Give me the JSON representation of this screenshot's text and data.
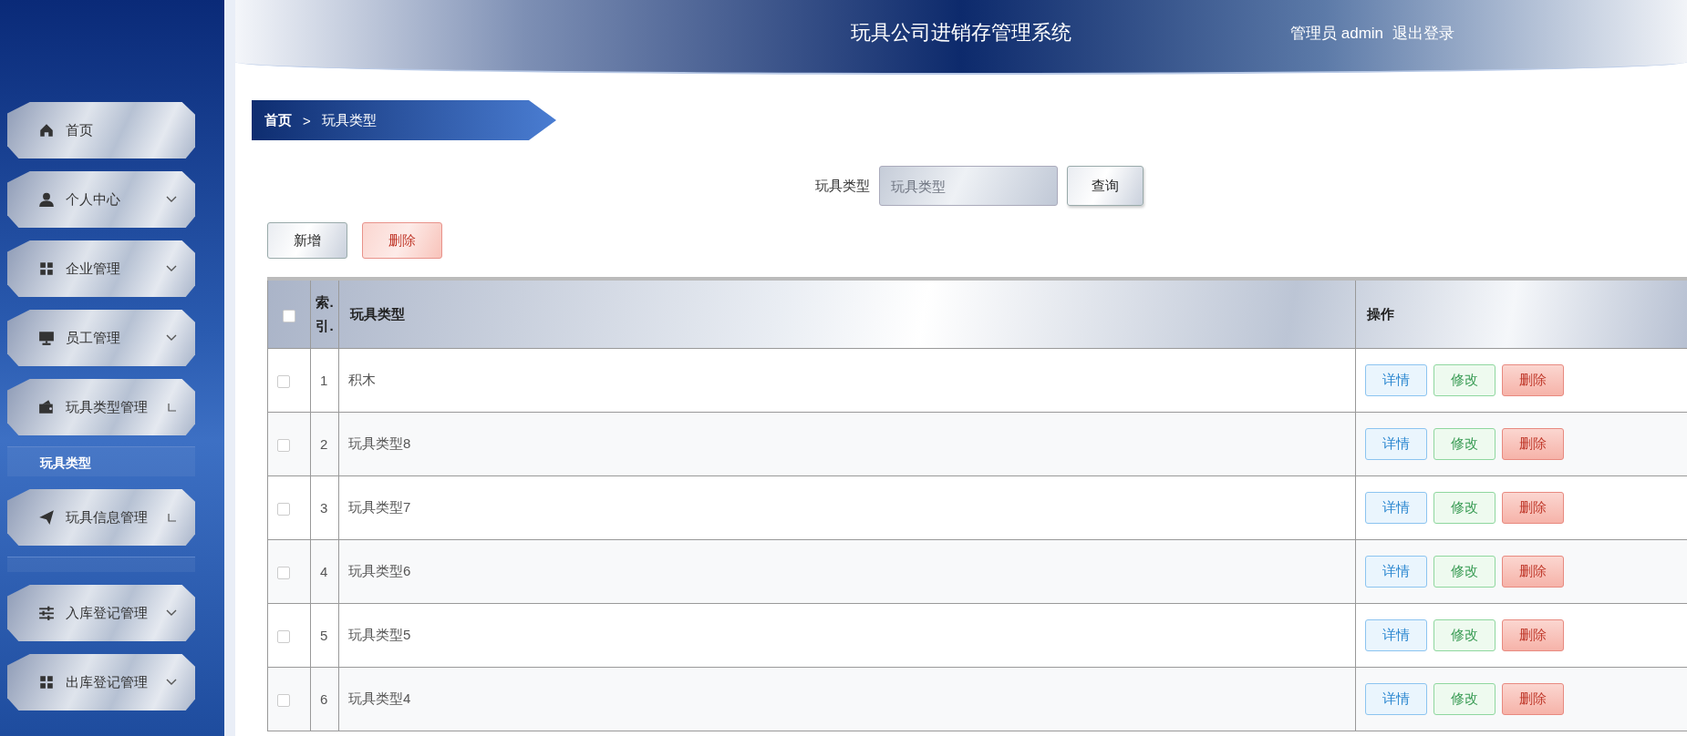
{
  "header": {
    "title": "玩具公司进销存管理系统",
    "user": "管理员 admin",
    "logout": "退出登录"
  },
  "sidebar": {
    "items": [
      {
        "label": "首页",
        "kind": "link"
      },
      {
        "label": "个人中心",
        "kind": "menu",
        "expanded": false
      },
      {
        "label": "企业管理",
        "kind": "menu",
        "expanded": false
      },
      {
        "label": "员工管理",
        "kind": "menu",
        "expanded": false
      },
      {
        "label": "玩具类型管理",
        "kind": "menu",
        "expanded": true,
        "children": [
          {
            "label": "玩具类型"
          }
        ]
      },
      {
        "label": "玩具信息管理",
        "kind": "menu",
        "expanded": true
      },
      {
        "label": "入库登记管理",
        "kind": "menu",
        "expanded": false
      },
      {
        "label": "出库登记管理",
        "kind": "menu",
        "expanded": false
      }
    ]
  },
  "breadcrumb": [
    "首页",
    "玩具类型"
  ],
  "breadcrumb_separator": ">",
  "search": {
    "label": "玩具类型",
    "placeholder": "玩具类型",
    "button": "查询"
  },
  "actions": {
    "add": "新增",
    "delete": "删除"
  },
  "table": {
    "all_checked": false,
    "columns": [
      "索.\n引.",
      "玩具类型",
      "操作"
    ],
    "rows": [
      {
        "checked": false,
        "index": "1",
        "name": "积木",
        "actions": [
          "详情",
          "修改",
          "删除"
        ]
      },
      {
        "checked": false,
        "index": "2",
        "name": "玩具类型8",
        "actions": [
          "详情",
          "修改",
          "删除"
        ]
      },
      {
        "checked": false,
        "index": "3",
        "name": "玩具类型7",
        "actions": [
          "详情",
          "修改",
          "删除"
        ]
      },
      {
        "checked": false,
        "index": "4",
        "name": "玩具类型6",
        "actions": [
          "详情",
          "修改",
          "删除"
        ]
      },
      {
        "checked": false,
        "index": "5",
        "name": "玩具类型5",
        "actions": [
          "详情",
          "修改",
          "删除"
        ]
      },
      {
        "checked": false,
        "index": "6",
        "name": "玩具类型4",
        "actions": [
          "详情",
          "修改",
          "删除"
        ]
      }
    ]
  }
}
